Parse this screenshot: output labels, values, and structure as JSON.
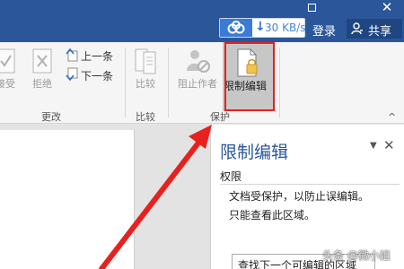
{
  "titlebar": {
    "speed": "30 KB/s",
    "login": "登录",
    "share": "共享"
  },
  "ribbon": {
    "buttons": {
      "accept_partial": "接受",
      "reject": "拒绝",
      "previous": "上一条",
      "next": "下一条",
      "compare": "比较",
      "block_authors": "阻止作者",
      "restrict_editing": "限制编辑"
    },
    "groups": {
      "changes": "更改",
      "compare": "比较",
      "protect": "保护"
    }
  },
  "pane": {
    "title": "限制编辑",
    "section": "权限",
    "line1": "文档受保护，以防止误编辑。",
    "line2": "只能查看此区域。",
    "find_button": "查找下一个可编辑的区域"
  },
  "watermark": "头条 @微小姐",
  "colors": {
    "titlebar": "#2b579a",
    "highlight": "#e8201e",
    "pane_title": "#2b579a"
  }
}
